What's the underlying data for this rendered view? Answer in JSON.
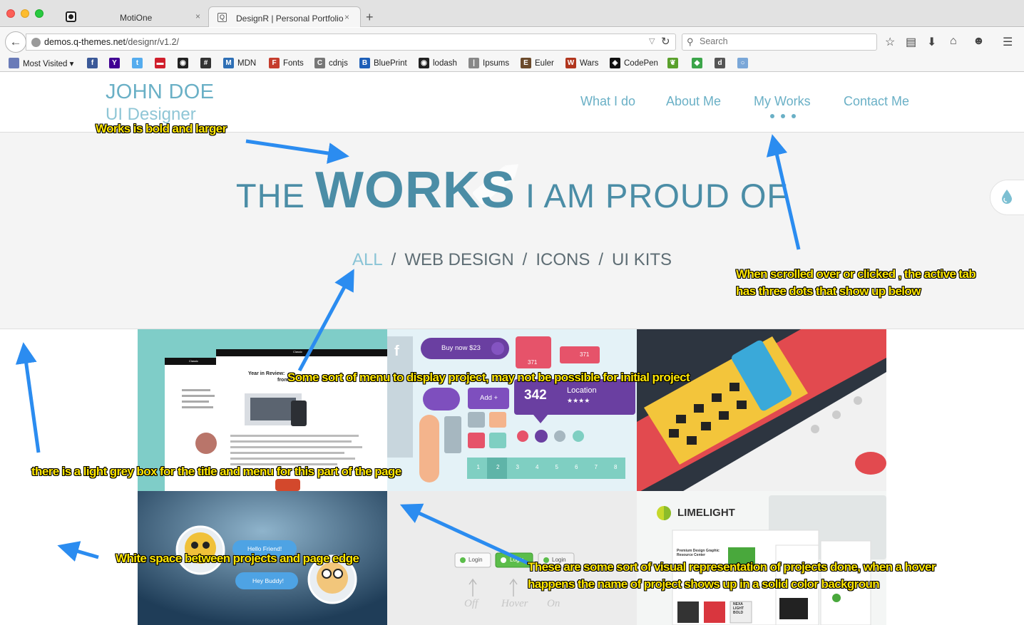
{
  "browser": {
    "tabs": [
      {
        "title": "MotiOne",
        "close": "×"
      },
      {
        "title": "DesignR | Personal Portfolio",
        "close": "×",
        "favicon": "Q"
      }
    ],
    "new_tab": "+",
    "url_host": "demos.q-themes.net",
    "url_path": "/designr/v1.2/",
    "search_placeholder": "Search",
    "bookmarks": [
      {
        "label": "Most Visited ▾",
        "icon": "folder-icon",
        "color": "#6a7bb8"
      },
      {
        "label": "",
        "icon": "facebook-icon",
        "color": "#3b5998",
        "glyph": "f"
      },
      {
        "label": "",
        "icon": "yahoo-icon",
        "color": "#410093",
        "glyph": "Y"
      },
      {
        "label": "",
        "icon": "twitter-icon",
        "color": "#55acee",
        "glyph": "t"
      },
      {
        "label": "",
        "icon": "dribbble-icon",
        "color": "#d01f2c",
        "glyph": "▬"
      },
      {
        "label": "",
        "icon": "github-icon",
        "color": "#222222",
        "glyph": "◉"
      },
      {
        "label": "",
        "icon": "hash-icon",
        "color": "#333333",
        "glyph": "#"
      },
      {
        "label": "MDN",
        "icon": "mdn-icon",
        "color": "#2e6fb5",
        "glyph": "M"
      },
      {
        "label": "Fonts",
        "icon": "fonts-icon",
        "color": "#c53d2d",
        "glyph": "F"
      },
      {
        "label": "cdnjs",
        "icon": "cdnjs-icon",
        "color": "#777777",
        "glyph": "C"
      },
      {
        "label": "BluePrint",
        "icon": "blueprint-icon",
        "color": "#1e5fb8",
        "glyph": "B"
      },
      {
        "label": "lodash",
        "icon": "lodash-github-icon",
        "color": "#222222",
        "glyph": "◉"
      },
      {
        "label": "Ipsums",
        "icon": "ipsums-icon",
        "color": "#888888",
        "glyph": "|"
      },
      {
        "label": "Euler",
        "icon": "euler-icon",
        "color": "#6b4a2b",
        "glyph": "E"
      },
      {
        "label": "Wars",
        "icon": "codewars-icon",
        "color": "#b1361e",
        "glyph": "W"
      },
      {
        "label": "CodePen",
        "icon": "codepen-icon",
        "color": "#111111",
        "glyph": "◈"
      },
      {
        "label": "",
        "icon": "leaf-icon",
        "color": "#5aa02c",
        "glyph": "❦"
      },
      {
        "label": "",
        "icon": "shield-icon",
        "color": "#3ca54a",
        "glyph": "◆"
      },
      {
        "label": "",
        "icon": "doc-icon",
        "color": "#555555",
        "glyph": "d"
      },
      {
        "label": "",
        "icon": "circle-icon",
        "color": "#7aa7d8",
        "glyph": "○"
      }
    ]
  },
  "site": {
    "brand_name": "JOHN DOE",
    "brand_role": "UI Designer",
    "nav": [
      "What I do",
      "About Me",
      "My Works",
      "Contact Me"
    ],
    "active_nav": "My Works",
    "hero": {
      "pre": "THE ",
      "big": "WORKS",
      "post": " I AM PROUD OF"
    },
    "filters": [
      "ALL",
      "WEB DESIGN",
      "ICONS",
      "UI KITS"
    ],
    "filter_separator": "/",
    "active_filter": "ALL",
    "tiles": {
      "blog": {
        "title": "Year in Review:",
        "title2": "fron",
        "brand": "Classic"
      },
      "uikit": {
        "buy": "Buy now $23",
        "likes": "371",
        "likes2": "371",
        "add": "Add +",
        "count": "342",
        "location": "Location",
        "stars": "★★★★",
        "pages": [
          "1",
          "2",
          "3",
          "4",
          "5",
          "6",
          "7",
          "8"
        ]
      },
      "chat": {
        "bubble1": "Hello Friend!",
        "bubble2": "Hey Buddy!"
      },
      "buttons": {
        "login": "Login",
        "states": [
          "Off",
          "Hover",
          "On"
        ]
      },
      "limelight": {
        "brand": "LIMELIGHT",
        "heading": "Premium Design Graphic Resource Center",
        "nexa": "NEXA LIGHT BOLD"
      }
    }
  },
  "annotations": [
    "Works is bold and larger",
    "When scrolled over or clicked , the active tab",
    "has three dots that show up below",
    "Some sort of menu to display project, may not be possible for initial project",
    "there is a light grey box for the title and menu for this part of the page",
    "White space between projects and page edge",
    "These are some sort of visual representation of projects done, when a hover",
    "happens the name of project shows up in a solid color backgroun"
  ],
  "colors": {
    "accent": "#6ab0c6",
    "hero_text": "#4b8da6",
    "annotation": "#ffe600",
    "arrow": "#2b8cf0"
  }
}
